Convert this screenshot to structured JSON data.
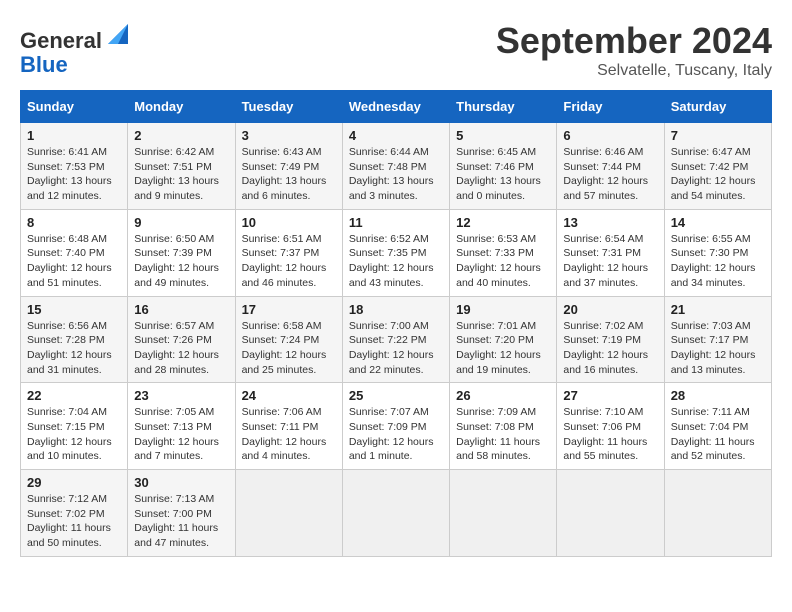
{
  "header": {
    "logo_line1": "General",
    "logo_line2": "Blue",
    "month": "September 2024",
    "location": "Selvatelle, Tuscany, Italy"
  },
  "columns": [
    "Sunday",
    "Monday",
    "Tuesday",
    "Wednesday",
    "Thursday",
    "Friday",
    "Saturday"
  ],
  "weeks": [
    [
      {
        "day": "1",
        "info": "Sunrise: 6:41 AM\nSunset: 7:53 PM\nDaylight: 13 hours and 12 minutes."
      },
      {
        "day": "2",
        "info": "Sunrise: 6:42 AM\nSunset: 7:51 PM\nDaylight: 13 hours and 9 minutes."
      },
      {
        "day": "3",
        "info": "Sunrise: 6:43 AM\nSunset: 7:49 PM\nDaylight: 13 hours and 6 minutes."
      },
      {
        "day": "4",
        "info": "Sunrise: 6:44 AM\nSunset: 7:48 PM\nDaylight: 13 hours and 3 minutes."
      },
      {
        "day": "5",
        "info": "Sunrise: 6:45 AM\nSunset: 7:46 PM\nDaylight: 13 hours and 0 minutes."
      },
      {
        "day": "6",
        "info": "Sunrise: 6:46 AM\nSunset: 7:44 PM\nDaylight: 12 hours and 57 minutes."
      },
      {
        "day": "7",
        "info": "Sunrise: 6:47 AM\nSunset: 7:42 PM\nDaylight: 12 hours and 54 minutes."
      }
    ],
    [
      {
        "day": "8",
        "info": "Sunrise: 6:48 AM\nSunset: 7:40 PM\nDaylight: 12 hours and 51 minutes."
      },
      {
        "day": "9",
        "info": "Sunrise: 6:50 AM\nSunset: 7:39 PM\nDaylight: 12 hours and 49 minutes."
      },
      {
        "day": "10",
        "info": "Sunrise: 6:51 AM\nSunset: 7:37 PM\nDaylight: 12 hours and 46 minutes."
      },
      {
        "day": "11",
        "info": "Sunrise: 6:52 AM\nSunset: 7:35 PM\nDaylight: 12 hours and 43 minutes."
      },
      {
        "day": "12",
        "info": "Sunrise: 6:53 AM\nSunset: 7:33 PM\nDaylight: 12 hours and 40 minutes."
      },
      {
        "day": "13",
        "info": "Sunrise: 6:54 AM\nSunset: 7:31 PM\nDaylight: 12 hours and 37 minutes."
      },
      {
        "day": "14",
        "info": "Sunrise: 6:55 AM\nSunset: 7:30 PM\nDaylight: 12 hours and 34 minutes."
      }
    ],
    [
      {
        "day": "15",
        "info": "Sunrise: 6:56 AM\nSunset: 7:28 PM\nDaylight: 12 hours and 31 minutes."
      },
      {
        "day": "16",
        "info": "Sunrise: 6:57 AM\nSunset: 7:26 PM\nDaylight: 12 hours and 28 minutes."
      },
      {
        "day": "17",
        "info": "Sunrise: 6:58 AM\nSunset: 7:24 PM\nDaylight: 12 hours and 25 minutes."
      },
      {
        "day": "18",
        "info": "Sunrise: 7:00 AM\nSunset: 7:22 PM\nDaylight: 12 hours and 22 minutes."
      },
      {
        "day": "19",
        "info": "Sunrise: 7:01 AM\nSunset: 7:20 PM\nDaylight: 12 hours and 19 minutes."
      },
      {
        "day": "20",
        "info": "Sunrise: 7:02 AM\nSunset: 7:19 PM\nDaylight: 12 hours and 16 minutes."
      },
      {
        "day": "21",
        "info": "Sunrise: 7:03 AM\nSunset: 7:17 PM\nDaylight: 12 hours and 13 minutes."
      }
    ],
    [
      {
        "day": "22",
        "info": "Sunrise: 7:04 AM\nSunset: 7:15 PM\nDaylight: 12 hours and 10 minutes."
      },
      {
        "day": "23",
        "info": "Sunrise: 7:05 AM\nSunset: 7:13 PM\nDaylight: 12 hours and 7 minutes."
      },
      {
        "day": "24",
        "info": "Sunrise: 7:06 AM\nSunset: 7:11 PM\nDaylight: 12 hours and 4 minutes."
      },
      {
        "day": "25",
        "info": "Sunrise: 7:07 AM\nSunset: 7:09 PM\nDaylight: 12 hours and 1 minute."
      },
      {
        "day": "26",
        "info": "Sunrise: 7:09 AM\nSunset: 7:08 PM\nDaylight: 11 hours and 58 minutes."
      },
      {
        "day": "27",
        "info": "Sunrise: 7:10 AM\nSunset: 7:06 PM\nDaylight: 11 hours and 55 minutes."
      },
      {
        "day": "28",
        "info": "Sunrise: 7:11 AM\nSunset: 7:04 PM\nDaylight: 11 hours and 52 minutes."
      }
    ],
    [
      {
        "day": "29",
        "info": "Sunrise: 7:12 AM\nSunset: 7:02 PM\nDaylight: 11 hours and 50 minutes."
      },
      {
        "day": "30",
        "info": "Sunrise: 7:13 AM\nSunset: 7:00 PM\nDaylight: 11 hours and 47 minutes."
      },
      {
        "day": "",
        "info": ""
      },
      {
        "day": "",
        "info": ""
      },
      {
        "day": "",
        "info": ""
      },
      {
        "day": "",
        "info": ""
      },
      {
        "day": "",
        "info": ""
      }
    ]
  ]
}
